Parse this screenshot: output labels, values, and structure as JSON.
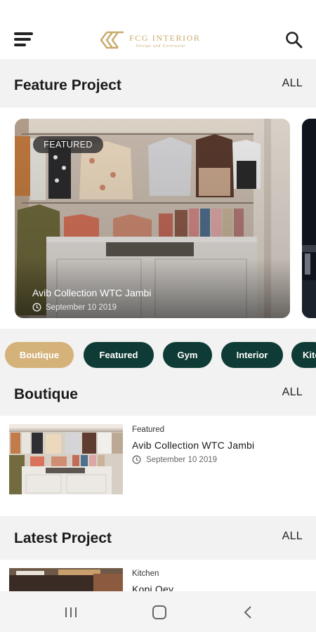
{
  "brand": {
    "title": "FCG INTERIOR",
    "subtitle": "Design and Contractor",
    "color": "#c9a96a"
  },
  "icons": {
    "menu": "hamburger-menu-icon",
    "search": "search-icon",
    "clock": "clock-icon",
    "nav_recents": "recents-icon",
    "nav_home": "home-icon",
    "nav_back": "back-icon"
  },
  "feature_section": {
    "title": "Feature Project",
    "all_label": "ALL",
    "card": {
      "badge": "FEATURED",
      "name": "Avib Collection WTC Jambi",
      "date": "September 10 2019"
    }
  },
  "categories": [
    {
      "label": "Boutique",
      "active": true
    },
    {
      "label": "Featured",
      "active": false
    },
    {
      "label": "Gym",
      "active": false
    },
    {
      "label": "Interior",
      "active": false
    },
    {
      "label": "Kitchen",
      "active": false
    }
  ],
  "boutique_section": {
    "title": "Boutique",
    "all_label": "ALL",
    "items": [
      {
        "category": "Featured",
        "name": "Avib Collection WTC Jambi",
        "date": "September 10 2019"
      }
    ]
  },
  "latest_section": {
    "title": "Latest Project",
    "all_label": "ALL",
    "items": [
      {
        "category": "Kitchen",
        "name": "Kopi Oey"
      }
    ]
  },
  "colors": {
    "accent": "#d4b27a",
    "chip_dark": "#0f3b36",
    "background": "#f2f2f2"
  }
}
